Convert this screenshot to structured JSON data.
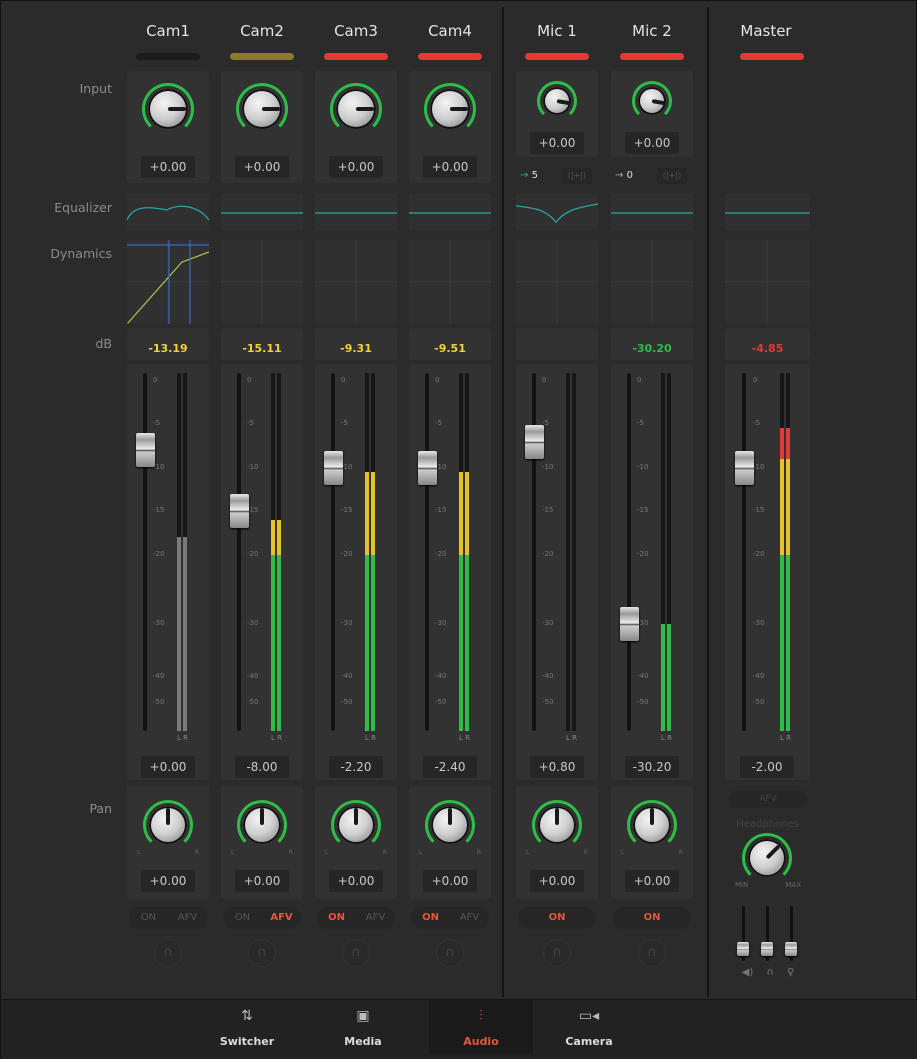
{
  "row_labels": {
    "input": "Input",
    "equalizer": "Equalizer",
    "dynamics": "Dynamics",
    "db": "dB",
    "pan": "Pan"
  },
  "scale": [
    "0",
    "-5",
    "-10",
    "-15",
    "-20",
    "-30",
    "-40",
    "-50"
  ],
  "channels": [
    {
      "name": "Cam1",
      "tally": "#1c1c1c",
      "input_value": "+0.00",
      "has_eq": true,
      "has_dyn": true,
      "db_readout": "-13.19",
      "db_color": "#f2d23a",
      "fader_value": "+0.00",
      "fader_db": -8,
      "meter_db": -18,
      "meter_gray": true,
      "pan_value": "+0.00",
      "on_label": "ON",
      "on_active": false,
      "afv_label": "AFV",
      "afv_active": false,
      "type": "cam"
    },
    {
      "name": "Cam2",
      "tally": "#8a7a2a",
      "input_value": "+0.00",
      "has_eq": false,
      "has_dyn": false,
      "db_readout": "-15.11",
      "db_color": "#f2d23a",
      "fader_value": "-8.00",
      "fader_db": -15,
      "meter_db": -16,
      "meter_gray": false,
      "pan_value": "+0.00",
      "on_label": "ON",
      "on_active": false,
      "afv_label": "AFV",
      "afv_active": true,
      "type": "cam"
    },
    {
      "name": "Cam3",
      "tally": "#e53935",
      "input_value": "+0.00",
      "has_eq": false,
      "has_dyn": false,
      "db_readout": "-9.31",
      "db_color": "#f2d23a",
      "fader_value": "-2.20",
      "fader_db": -10,
      "meter_db": -10.5,
      "meter_gray": false,
      "pan_value": "+0.00",
      "on_label": "ON",
      "on_active": true,
      "afv_label": "AFV",
      "afv_active": false,
      "type": "cam"
    },
    {
      "name": "Cam4",
      "tally": "#e53935",
      "input_value": "+0.00",
      "has_eq": false,
      "has_dyn": false,
      "db_readout": "-9.51",
      "db_color": "#f2d23a",
      "fader_value": "-2.40",
      "fader_db": -10,
      "meter_db": -10.5,
      "meter_gray": false,
      "pan_value": "+0.00",
      "on_label": "ON",
      "on_active": true,
      "afv_label": "AFV",
      "afv_active": false,
      "type": "cam"
    },
    {
      "name": "Mic 1",
      "tally": "#e53935",
      "input_value": "+0.00",
      "route_num": "5",
      "route_color": "#2dbd48",
      "has_eq": true,
      "has_dyn": false,
      "db_readout": "",
      "db_color": "#f2d23a",
      "fader_value": "+0.80",
      "fader_db": -7,
      "meter_db": null,
      "meter_gray": false,
      "pan_value": "+0.00",
      "on_label": "ON",
      "on_active": true,
      "type": "mic"
    },
    {
      "name": "Mic 2",
      "tally": "#e53935",
      "input_value": "+0.00",
      "route_num": "0",
      "route_color": "#aaaaaa",
      "has_eq": false,
      "has_dyn": false,
      "db_readout": "-30.20",
      "db_color": "#2dbd48",
      "fader_value": "-30.20",
      "fader_db": -30,
      "meter_db": -30,
      "meter_gray": false,
      "pan_value": "+0.00",
      "on_label": "ON",
      "on_active": true,
      "type": "mic"
    }
  ],
  "master": {
    "name": "Master",
    "tally": "#e53935",
    "db_readout": "-4.85",
    "db_color": "#e53935",
    "fader_value": "-2.00",
    "fader_db": -10,
    "meter_db": -5.5,
    "afv_label": "AFV",
    "headphones_label": "Headphones",
    "min_label": "MIN",
    "max_label": "MAX"
  },
  "tabs": [
    {
      "label": "Switcher",
      "icon": "switcher-icon",
      "active": false
    },
    {
      "label": "Media",
      "icon": "media-icon",
      "active": false
    },
    {
      "label": "Audio",
      "icon": "audio-icon",
      "active": true
    },
    {
      "label": "Camera",
      "icon": "camera-icon",
      "active": false
    }
  ],
  "colors": {
    "green": "#2dbd48",
    "yellow": "#e6c229",
    "red": "#e53935",
    "accent": "#e8553a"
  }
}
